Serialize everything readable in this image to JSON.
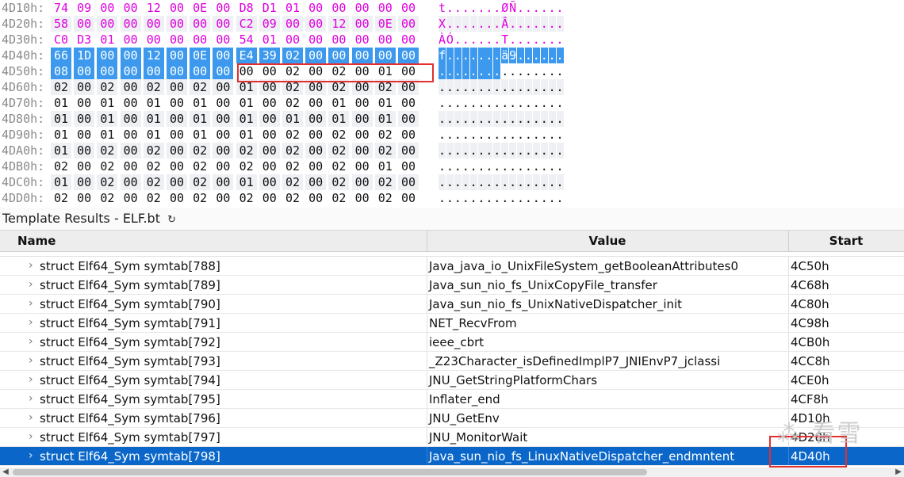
{
  "hex": {
    "rows": [
      {
        "addr": "4D10h:",
        "bytes": [
          "74",
          "09",
          "00",
          "00",
          "12",
          "00",
          "0E",
          "00",
          "D8",
          "D1",
          "01",
          "00",
          "00",
          "00",
          "00",
          "00"
        ],
        "ascii": "t.......ØÑ......"
      },
      {
        "addr": "4D20h:",
        "bytes": [
          "58",
          "00",
          "00",
          "00",
          "00",
          "00",
          "00",
          "00",
          "C2",
          "09",
          "00",
          "00",
          "12",
          "00",
          "0E",
          "00"
        ],
        "ascii": "X.......Â......."
      },
      {
        "addr": "4D30h:",
        "bytes": [
          "C0",
          "D3",
          "01",
          "00",
          "00",
          "00",
          "00",
          "00",
          "54",
          "01",
          "00",
          "00",
          "00",
          "00",
          "00",
          "00"
        ],
        "ascii": "ÀÓ......T......."
      },
      {
        "addr": "4D40h:",
        "bytes": [
          "66",
          "1D",
          "00",
          "00",
          "12",
          "00",
          "0E",
          "00",
          "E4",
          "39",
          "02",
          "00",
          "00",
          "00",
          "00",
          "00"
        ],
        "ascii": "f.......ä9......"
      },
      {
        "addr": "4D50h:",
        "bytes": [
          "08",
          "00",
          "00",
          "00",
          "00",
          "00",
          "00",
          "00",
          "00",
          "00",
          "02",
          "00",
          "02",
          "00",
          "01",
          "00"
        ],
        "ascii": "................"
      },
      {
        "addr": "4D60h:",
        "bytes": [
          "02",
          "00",
          "02",
          "00",
          "02",
          "00",
          "02",
          "00",
          "01",
          "00",
          "02",
          "00",
          "02",
          "00",
          "02",
          "00"
        ],
        "ascii": "................"
      },
      {
        "addr": "4D70h:",
        "bytes": [
          "01",
          "00",
          "01",
          "00",
          "01",
          "00",
          "01",
          "00",
          "01",
          "00",
          "02",
          "00",
          "01",
          "00",
          "01",
          "00"
        ],
        "ascii": "................"
      },
      {
        "addr": "4D80h:",
        "bytes": [
          "01",
          "00",
          "01",
          "00",
          "01",
          "00",
          "01",
          "00",
          "01",
          "00",
          "01",
          "00",
          "01",
          "00",
          "01",
          "00"
        ],
        "ascii": "................"
      },
      {
        "addr": "4D90h:",
        "bytes": [
          "01",
          "00",
          "01",
          "00",
          "01",
          "00",
          "01",
          "00",
          "01",
          "00",
          "02",
          "00",
          "02",
          "00",
          "02",
          "00"
        ],
        "ascii": "................"
      },
      {
        "addr": "4DA0h:",
        "bytes": [
          "01",
          "00",
          "02",
          "00",
          "02",
          "00",
          "02",
          "00",
          "02",
          "00",
          "02",
          "00",
          "02",
          "00",
          "02",
          "00"
        ],
        "ascii": "................"
      },
      {
        "addr": "4DB0h:",
        "bytes": [
          "02",
          "00",
          "02",
          "00",
          "02",
          "00",
          "02",
          "00",
          "02",
          "00",
          "02",
          "00",
          "02",
          "00",
          "01",
          "00"
        ],
        "ascii": "................"
      },
      {
        "addr": "4DC0h:",
        "bytes": [
          "01",
          "00",
          "02",
          "00",
          "02",
          "00",
          "02",
          "00",
          "01",
          "00",
          "02",
          "00",
          "02",
          "00",
          "02",
          "00"
        ],
        "ascii": "................"
      },
      {
        "addr": "4DD0h:",
        "bytes": [
          "02",
          "00",
          "02",
          "00",
          "02",
          "00",
          "02",
          "00",
          "02",
          "00",
          "02",
          "00",
          "02",
          "00",
          "02",
          "00"
        ],
        "ascii": "................"
      }
    ],
    "colors": {
      "pink": "#e000e0",
      "selection": "#3c99ee",
      "highlight_box": "#e03030",
      "alt_row": "#eef0f4"
    }
  },
  "template": {
    "title": "Template Results - ELF.bt",
    "refresh_icon": "refresh-icon",
    "columns": {
      "name": "Name",
      "value": "Value",
      "start": "Start"
    },
    "rows": [
      {
        "name": "struct Elf64_Sym symtab[788]",
        "value": "Java_java_io_UnixFileSystem_getBooleanAttributes0",
        "start": "4C50h"
      },
      {
        "name": "struct Elf64_Sym symtab[789]",
        "value": "Java_sun_nio_fs_UnixCopyFile_transfer",
        "start": "4C68h"
      },
      {
        "name": "struct Elf64_Sym symtab[790]",
        "value": "Java_sun_nio_fs_UnixNativeDispatcher_init",
        "start": "4C80h"
      },
      {
        "name": "struct Elf64_Sym symtab[791]",
        "value": "NET_RecvFrom",
        "start": "4C98h"
      },
      {
        "name": "struct Elf64_Sym symtab[792]",
        "value": "ieee_cbrt",
        "start": "4CB0h"
      },
      {
        "name": "struct Elf64_Sym symtab[793]",
        "value": "_Z23Character_isDefinedImplP7_JNIEnvP7_jclassi",
        "start": "4CC8h"
      },
      {
        "name": "struct Elf64_Sym symtab[794]",
        "value": "JNU_GetStringPlatformChars",
        "start": "4CE0h"
      },
      {
        "name": "struct Elf64_Sym symtab[795]",
        "value": "Inflater_end",
        "start": "4CF8h"
      },
      {
        "name": "struct Elf64_Sym symtab[796]",
        "value": "JNU_GetEnv",
        "start": "4D10h"
      },
      {
        "name": "struct Elf64_Sym symtab[797]",
        "value": "JNU_MonitorWait",
        "start": "4D28h"
      },
      {
        "name": "struct Elf64_Sym symtab[798]",
        "value": "Java_sun_nio_fs_LinuxNativeDispatcher_endmntent",
        "start": "4D40h"
      }
    ],
    "selected_index": 10,
    "selection_color": "#0a67c9"
  },
  "watermark": "看雪"
}
